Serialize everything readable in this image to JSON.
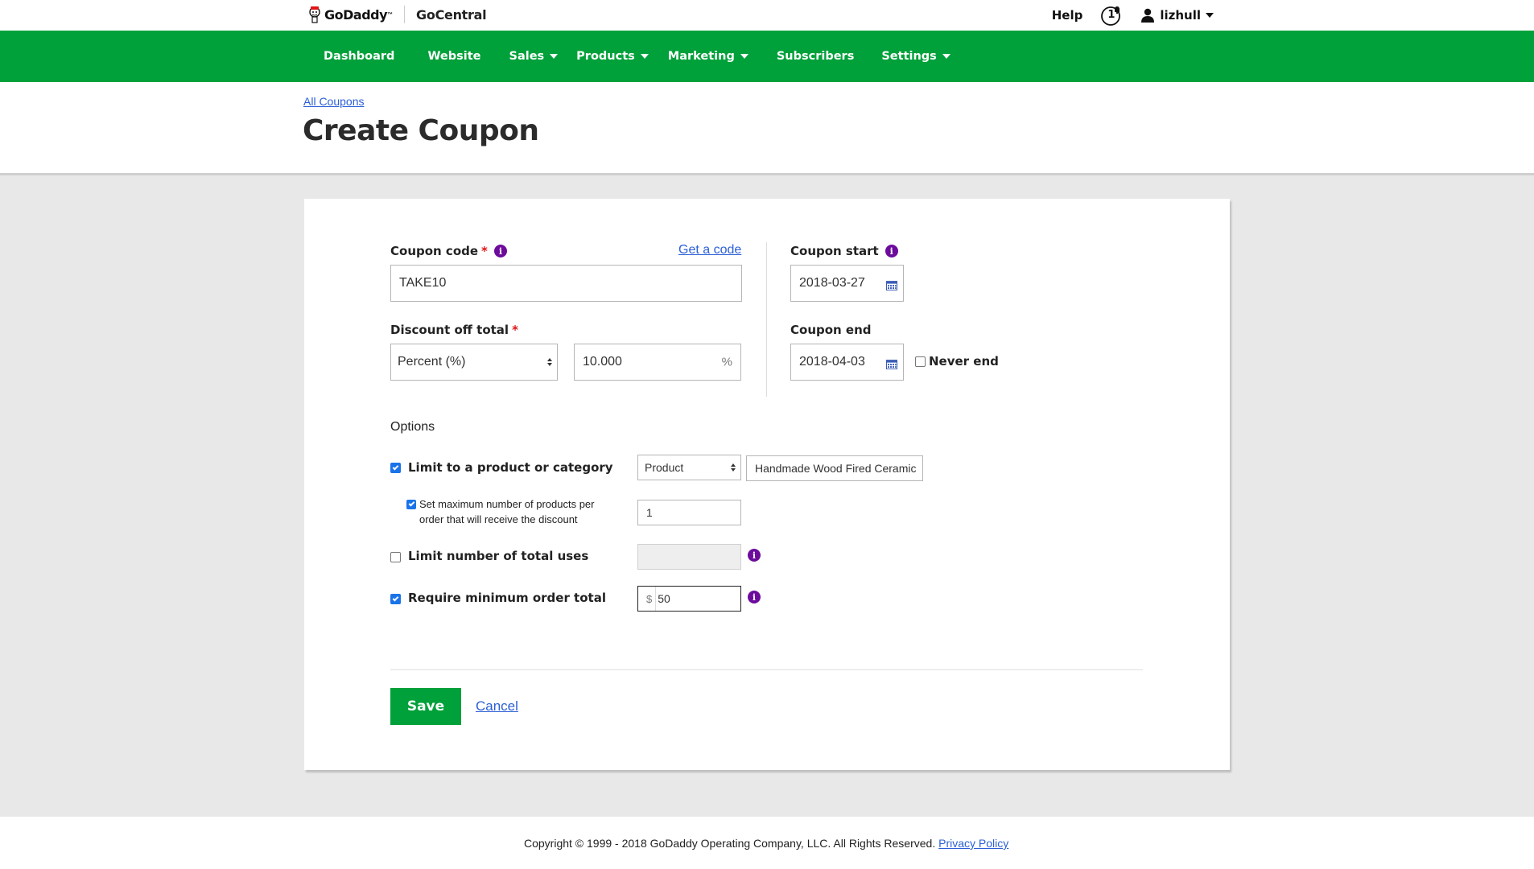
{
  "header": {
    "brand": "GoDaddy",
    "brand_tm": "™",
    "product": "GoCentral",
    "help": "Help",
    "notification_count": "1",
    "username": "lizhull"
  },
  "nav": {
    "items": [
      {
        "label": "Dashboard",
        "dropdown": false
      },
      {
        "label": "Website",
        "dropdown": false
      },
      {
        "label": "Sales",
        "dropdown": true
      },
      {
        "label": "Products",
        "dropdown": true
      },
      {
        "label": "Marketing",
        "dropdown": true
      },
      {
        "label": "Subscribers",
        "dropdown": false
      },
      {
        "label": "Settings",
        "dropdown": true
      }
    ]
  },
  "page": {
    "breadcrumb": "All Coupons",
    "title": "Create Coupon"
  },
  "form": {
    "coupon_code_label": "Coupon code",
    "required_mark": "*",
    "get_code_link": "Get a code",
    "coupon_code_value": "TAKE10",
    "discount_label": "Discount off total",
    "discount_type": "Percent (%)",
    "discount_value": "10.000",
    "discount_suffix": "%",
    "coupon_start_label": "Coupon start",
    "coupon_start_value": "2018-03-27",
    "coupon_end_label": "Coupon end",
    "coupon_end_value": "2018-04-03",
    "never_end_label": "Never end",
    "options_label": "Options",
    "limit_product_label": "Limit to a product or category",
    "limit_product_type": "Product",
    "limit_product_value": "Handmade Wood Fired Ceramic",
    "max_products_label_line1": "Set maximum number of products per",
    "max_products_label_line2": "order that will receive the discount",
    "max_products_value": "1",
    "limit_uses_label": "Limit number of total uses",
    "limit_uses_value": "",
    "min_order_label": "Require minimum order total",
    "min_order_prefix": "$",
    "min_order_value": "50",
    "save_label": "Save",
    "cancel_label": "Cancel"
  },
  "checkboxes": {
    "never_end": false,
    "limit_product": true,
    "max_products": true,
    "limit_uses": false,
    "min_order": true
  },
  "footer": {
    "copyright": "Copyright © 1999 - 2018 GoDaddy Operating Company, LLC. All Rights Reserved.",
    "privacy_link": "Privacy Policy"
  },
  "colors": {
    "brand_green": "#00a13a",
    "link_blue": "#2c5fd6",
    "info_purple": "#6c0b9c",
    "required_red": "#e01414"
  }
}
